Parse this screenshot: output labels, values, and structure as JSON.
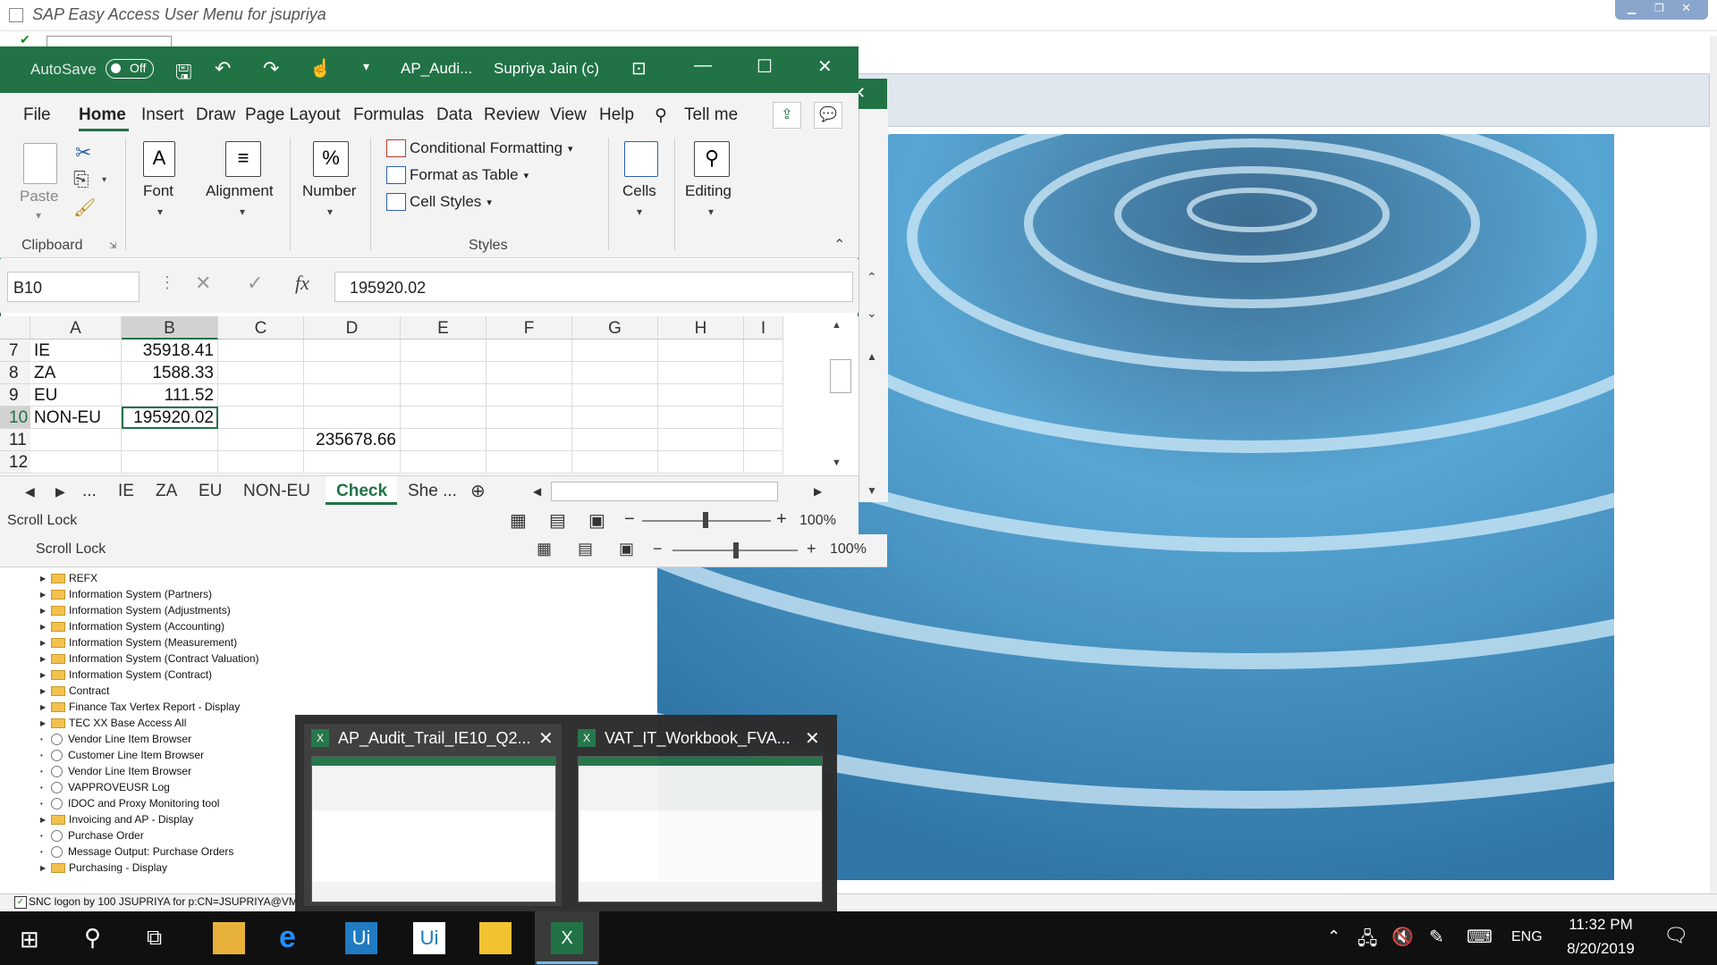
{
  "sap": {
    "title": "SAP Easy Access   User Menu for jsupriya",
    "status": "SNC logon by 100 JSUPRIYA for p:CN=JSUPRIYA@VM",
    "tree_items": [
      {
        "label": "REFX",
        "type": "folder"
      },
      {
        "label": "Information System (Partners)",
        "type": "folder"
      },
      {
        "label": "Information System (Adjustments)",
        "type": "folder"
      },
      {
        "label": "Information System (Accounting)",
        "type": "folder"
      },
      {
        "label": "Information System (Measurement)",
        "type": "folder"
      },
      {
        "label": "Information System (Contract Valuation)",
        "type": "folder"
      },
      {
        "label": "Information System (Contract)",
        "type": "folder"
      },
      {
        "label": "Contract",
        "type": "folder"
      },
      {
        "label": "Finance Tax Vertex Report - Display",
        "type": "folder"
      },
      {
        "label": "TEC XX Base Access All",
        "type": "folder"
      },
      {
        "label": "Vendor Line Item Browser",
        "type": "tx"
      },
      {
        "label": "Customer Line Item Browser",
        "type": "tx"
      },
      {
        "label": "Vendor Line Item Browser",
        "type": "tx"
      },
      {
        "label": "VAPPROVEUSR Log",
        "type": "tx"
      },
      {
        "label": "IDOC and Proxy Monitoring tool",
        "type": "tx"
      },
      {
        "label": "Invoicing and AP - Display",
        "type": "folder"
      },
      {
        "label": "Purchase Order",
        "type": "tx"
      },
      {
        "label": "Message Output: Purchase Orders",
        "type": "tx"
      },
      {
        "label": "Purchasing - Display",
        "type": "folder"
      }
    ]
  },
  "excel": {
    "autosave": "AutoSave",
    "autosave_state": "Off",
    "doc_title": "AP_Audi...",
    "user": "Supriya Jain (c)",
    "tabs": [
      "File",
      "Home",
      "Insert",
      "Draw",
      "Page Layout",
      "Formulas",
      "Data",
      "Review",
      "View",
      "Help"
    ],
    "tell_me": "Tell me",
    "ribbon": {
      "paste": "Paste",
      "clipboard": "Clipboard",
      "font": "Font",
      "alignment": "Alignment",
      "number": "Number",
      "cond_format": "Conditional Formatting",
      "format_table": "Format as Table",
      "cell_styles": "Cell Styles",
      "styles": "Styles",
      "cells": "Cells",
      "editing": "Editing",
      "fx": "fx"
    },
    "name_box": "B10",
    "formula_value": "195920.02",
    "columns": [
      "A",
      "B",
      "C",
      "D",
      "E",
      "F",
      "G",
      "H",
      "I"
    ],
    "rows": [
      {
        "num": "7",
        "a": "IE",
        "b": "35918.41",
        "d": ""
      },
      {
        "num": "8",
        "a": "ZA",
        "b": "1588.33",
        "d": ""
      },
      {
        "num": "9",
        "a": "EU",
        "b": "111.52",
        "d": ""
      },
      {
        "num": "10",
        "a": "NON-EU",
        "b": "195920.02",
        "d": ""
      },
      {
        "num": "11",
        "a": "",
        "b": "",
        "d": "235678.66"
      },
      {
        "num": "12",
        "a": "",
        "b": "",
        "d": ""
      }
    ],
    "sheet_tabs": [
      "...",
      "IE",
      "ZA",
      "EU",
      "NON-EU",
      "Check",
      "She ..."
    ],
    "active_sheet": "Check",
    "status": "Scroll Lock",
    "zoom": "100%",
    "status2": "Scroll Lock",
    "zoom2": "100%"
  },
  "thumbnails": [
    {
      "title": "AP_Audit_Trail_IE10_Q2..."
    },
    {
      "title": "VAT_IT_Workbook_FVA..."
    }
  ],
  "taskbar": {
    "time": "11:32 PM",
    "date": "8/20/2019",
    "lang": "ENG"
  }
}
